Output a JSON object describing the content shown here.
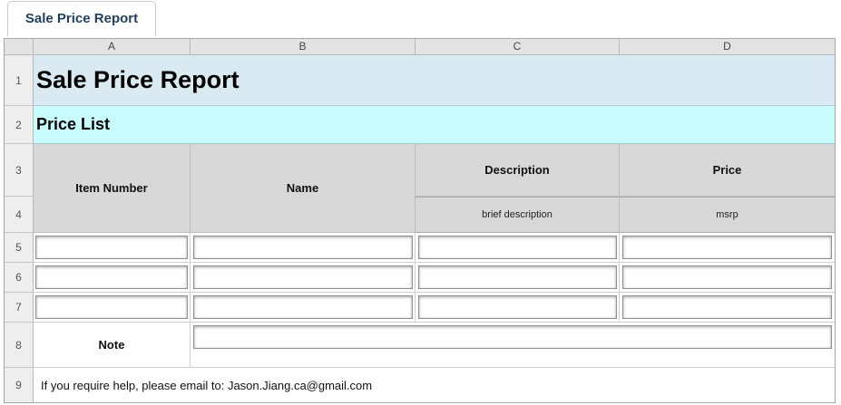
{
  "tab": {
    "label": "Sale Price Report"
  },
  "columns": [
    "A",
    "B",
    "C",
    "D"
  ],
  "rows": [
    "1",
    "2",
    "3",
    "4",
    "5",
    "6",
    "7",
    "8",
    "9"
  ],
  "report": {
    "title": "Sale Price Report",
    "subtitle": "Price List",
    "headers": {
      "item_number": "Item Number",
      "name": "Name",
      "description": "Description",
      "description_sub": "brief description",
      "price": "Price",
      "price_sub": "msrp"
    },
    "note_label": "Note",
    "footer": "If you require help, please email to: Jason.Jiang.ca@gmail.com"
  },
  "entries": [
    {
      "item_number": "",
      "name": "",
      "description": "",
      "price": ""
    },
    {
      "item_number": "",
      "name": "",
      "description": "",
      "price": ""
    },
    {
      "item_number": "",
      "name": "",
      "description": "",
      "price": ""
    }
  ],
  "note_value": ""
}
